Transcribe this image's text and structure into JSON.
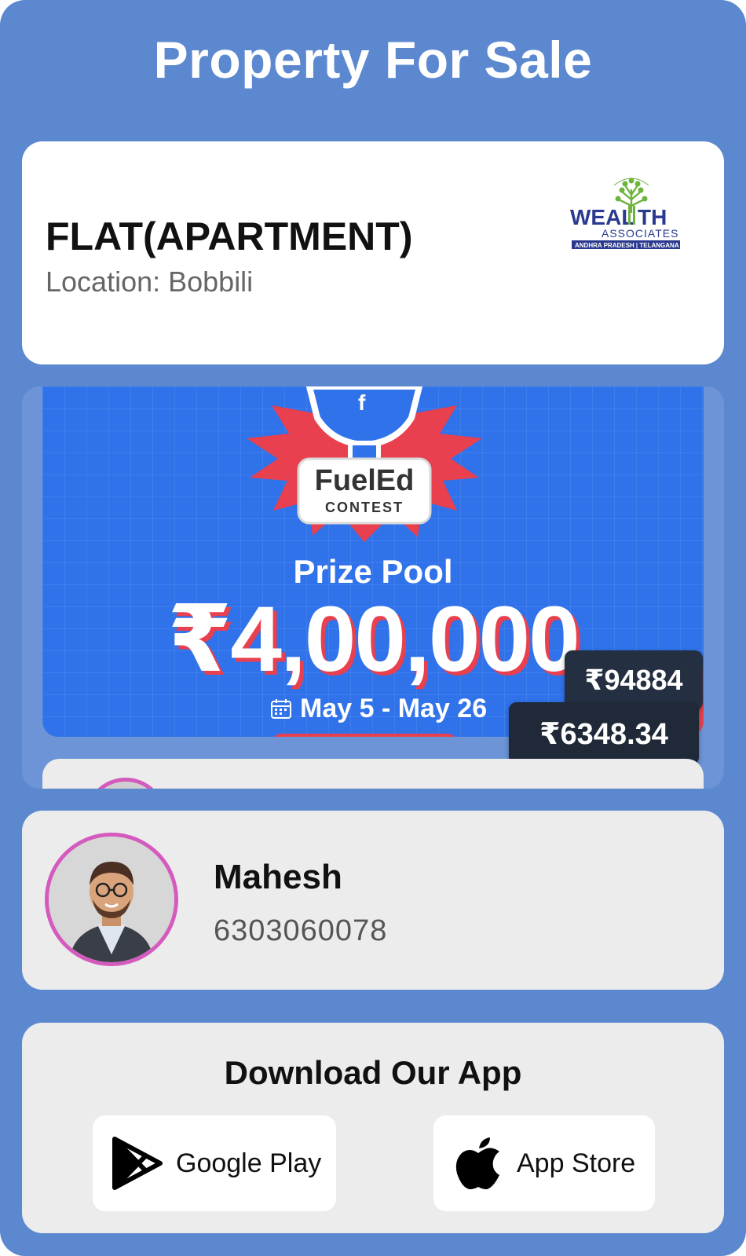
{
  "page": {
    "title": "Property For Sale"
  },
  "property": {
    "type": "FLAT(APARTMENT)",
    "location": "Location: Bobbili",
    "logo": {
      "brand_top": "WEAL",
      "brand_tail": "TH",
      "brand_sub": "ASSOCIATES",
      "brand_region": "ANDHRA PRADESH | TELANGANA",
      "color_primary": "#2b3a8f",
      "color_tree": "#6fb33f"
    }
  },
  "ad": {
    "brand": "FuelEd",
    "contest": "CONTEST",
    "prize_label": "Prize Pool",
    "prize_amount": "₹4,00,000",
    "date_range": "May 5 - May 26",
    "badges": [
      "₹94884",
      "₹6348.34"
    ],
    "colors": {
      "background": "#2f72ea",
      "accent": "#e8404f"
    }
  },
  "agent": {
    "name": "Mahesh",
    "phone": "6303060078",
    "avatar_icon": "agent-avatar",
    "ring_color": "#d45bbd"
  },
  "download": {
    "title": "Download Our App",
    "google_play": {
      "label": "Google Play",
      "icon": "google-play-icon"
    },
    "app_store": {
      "label": "App Store",
      "icon": "apple-icon"
    }
  },
  "colors": {
    "page_background": "#5b88cf",
    "card_background": "#ececec"
  }
}
